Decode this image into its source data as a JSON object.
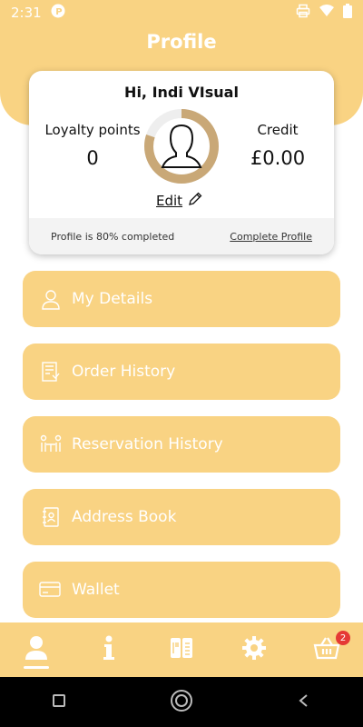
{
  "status_bar": {
    "time": "2:31"
  },
  "header": {
    "title": "Profile"
  },
  "profile": {
    "greeting": "Hi, Indi VIsual",
    "loyalty_label": "Loyalty points",
    "loyalty_value": "0",
    "credit_label": "Credit",
    "credit_value": "£0.00",
    "edit_label": "Edit",
    "completion_text": "Profile is 80% completed",
    "completion_percent": 80,
    "complete_link": "Complete Profile"
  },
  "menu": {
    "items": [
      {
        "label": "My Details",
        "icon": "person-icon"
      },
      {
        "label": "Order History",
        "icon": "receipt-icon"
      },
      {
        "label": "Reservation History",
        "icon": "dining-table-icon"
      },
      {
        "label": "Address Book",
        "icon": "contact-book-icon"
      },
      {
        "label": "Wallet",
        "icon": "credit-card-icon"
      }
    ]
  },
  "bottom_nav": {
    "items": [
      {
        "icon": "profile-icon",
        "active": true
      },
      {
        "icon": "info-icon"
      },
      {
        "icon": "menu-book-icon"
      },
      {
        "icon": "settings-gear-icon"
      },
      {
        "icon": "basket-icon",
        "badge": "2"
      }
    ]
  },
  "colors": {
    "accent": "#f9d383",
    "ring": "#c9a877",
    "badge": "#e53935"
  }
}
